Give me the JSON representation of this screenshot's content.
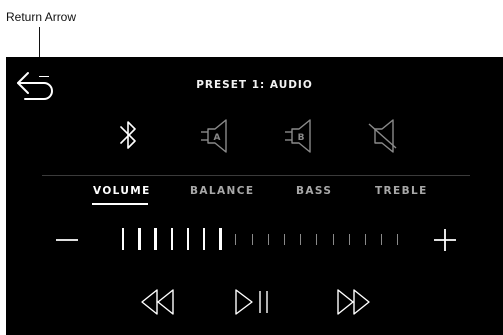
{
  "annotation": {
    "label": "Return Arrow"
  },
  "header": {
    "title": "PRESET 1: AUDIO"
  },
  "sources": [
    {
      "icon": "bluetooth-icon"
    },
    {
      "icon": "aux-a-icon",
      "label": "A"
    },
    {
      "icon": "aux-b-icon",
      "label": "B"
    },
    {
      "icon": "mute-speaker-icon"
    }
  ],
  "tabs": [
    {
      "label": "VOLUME",
      "active": true
    },
    {
      "label": "BALANCE",
      "active": false
    },
    {
      "label": "BASS",
      "active": false
    },
    {
      "label": "TREBLE",
      "active": false
    }
  ],
  "volume": {
    "level": 7,
    "max": 18
  },
  "playback": [
    "rewind-icon",
    "play-pause-icon",
    "fast-forward-icon"
  ],
  "colors": {
    "background": "#000000",
    "foreground": "#ffffff",
    "dim": "#8a8a8a",
    "tab_inactive": "#a8a8a8"
  }
}
